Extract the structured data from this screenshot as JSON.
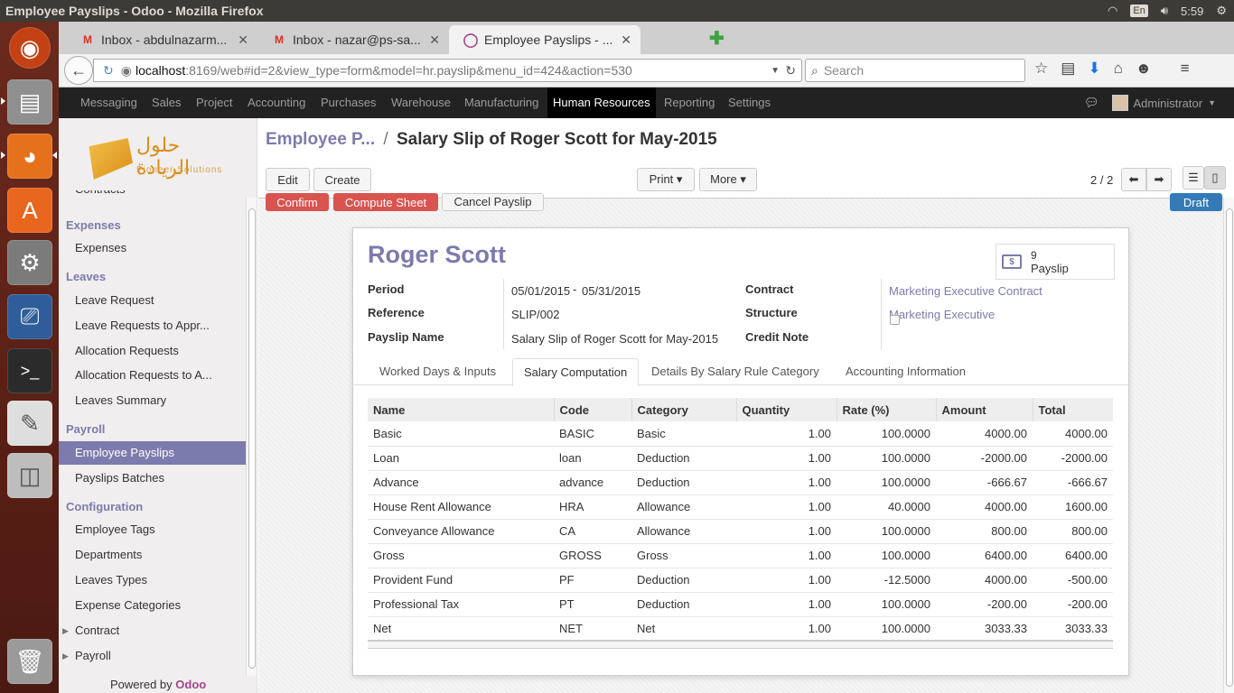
{
  "window": {
    "title": "Employee Payslips - Odoo - Mozilla Firefox"
  },
  "tray": {
    "keyboard": "En",
    "clock": "5:59"
  },
  "launcher": {
    "items": [
      "ubuntu-logo",
      "files",
      "firefox",
      "software-center",
      "system-settings",
      "remote-desktop",
      "terminal",
      "text-editor",
      "disk",
      "trash"
    ]
  },
  "browser": {
    "tabs": [
      {
        "label": "Inbox - abdulnazarm...",
        "icon": "gmail-icon"
      },
      {
        "label": "Inbox - nazar@ps-sa...",
        "icon": "gmail-icon"
      },
      {
        "label": "Employee Payslips - ...",
        "icon": "odoo-icon"
      }
    ],
    "url_host": "localhost",
    "url_rest": ":8169/web#id=2&view_type=form&model=hr.payslip&menu_id=424&action=530",
    "search_placeholder": "Search"
  },
  "topmenu": {
    "items": [
      "Messaging",
      "Sales",
      "Project",
      "Accounting",
      "Purchases",
      "Warehouse",
      "Manufacturing",
      "Human Resources",
      "Reporting",
      "Settings"
    ],
    "active": "Human Resources",
    "user": "Administrator"
  },
  "sidebar": {
    "logo_ar": "حلول الريادة",
    "logo_en": "Pioneer Solutions",
    "partial_item": "Contracts",
    "sections": [
      {
        "title": "Expenses",
        "items": [
          "Expenses"
        ]
      },
      {
        "title": "Leaves",
        "items": [
          "Leave Request",
          "Leave Requests to Appr...",
          "Allocation Requests",
          "Allocation Requests to A...",
          "Leaves Summary"
        ]
      },
      {
        "title": "Payroll",
        "items": [
          "Employee Payslips",
          "Payslips Batches"
        ]
      },
      {
        "title": "Configuration",
        "items": [
          "Employee Tags",
          "Departments",
          "Leaves Types",
          "Expense Categories",
          "Contract",
          "Payroll"
        ]
      }
    ],
    "active_item": "Employee Payslips",
    "powered_by": "Powered by",
    "powered_brand": "Odoo"
  },
  "content": {
    "breadcrumb_parent": "Employee P...",
    "breadcrumb_sep": "/",
    "breadcrumb_current": "Salary Slip of Roger Scott for May-2015",
    "buttons": {
      "edit": "Edit",
      "create": "Create",
      "print": "Print ▾",
      "more": "More ▾"
    },
    "pager": "2 / 2",
    "status_buttons": {
      "confirm": "Confirm",
      "compute": "Compute Sheet",
      "cancel": "Cancel Payslip",
      "state": "Draft"
    }
  },
  "form": {
    "employee": "Roger Scott",
    "payslip_count": "9",
    "payslip_label": "Payslip",
    "labels": {
      "period": "Period",
      "reference": "Reference",
      "payslip_name": "Payslip Name",
      "contract": "Contract",
      "structure": "Structure",
      "credit_note": "Credit Note"
    },
    "values": {
      "period_from": "05/01/2015",
      "period_sep": "-",
      "period_to": "05/31/2015",
      "reference": "SLIP/002",
      "payslip_name": "Salary Slip of Roger Scott for May-2015",
      "contract": "Marketing Executive Contract",
      "structure": "Marketing Executive",
      "credit_note": false
    },
    "tabs": [
      "Worked Days & Inputs",
      "Salary Computation",
      "Details By Salary Rule Category",
      "Accounting Information"
    ],
    "active_tab": "Salary Computation",
    "columns": [
      "Name",
      "Code",
      "Category",
      "Quantity",
      "Rate (%)",
      "Amount",
      "Total"
    ],
    "rows": [
      [
        "Basic",
        "BASIC",
        "Basic",
        "1.00",
        "100.0000",
        "4000.00",
        "4000.00"
      ],
      [
        "Loan",
        "loan",
        "Deduction",
        "1.00",
        "100.0000",
        "-2000.00",
        "-2000.00"
      ],
      [
        "Advance",
        "advance",
        "Deduction",
        "1.00",
        "100.0000",
        "-666.67",
        "-666.67"
      ],
      [
        "House Rent Allowance",
        "HRA",
        "Allowance",
        "1.00",
        "40.0000",
        "4000.00",
        "1600.00"
      ],
      [
        "Conveyance Allowance",
        "CA",
        "Allowance",
        "1.00",
        "100.0000",
        "800.00",
        "800.00"
      ],
      [
        "Gross",
        "GROSS",
        "Gross",
        "1.00",
        "100.0000",
        "6400.00",
        "6400.00"
      ],
      [
        "Provident Fund",
        "PF",
        "Deduction",
        "1.00",
        "-12.5000",
        "4000.00",
        "-500.00"
      ],
      [
        "Professional Tax",
        "PT",
        "Deduction",
        "1.00",
        "100.0000",
        "-200.00",
        "-200.00"
      ],
      [
        "Net",
        "NET",
        "Net",
        "1.00",
        "100.0000",
        "3033.33",
        "3033.33"
      ]
    ]
  },
  "colors": {
    "odoo_purple": "#7c7bad",
    "topbar_dark": "#222222",
    "danger": "#d9534f",
    "primary": "#337ab7"
  }
}
